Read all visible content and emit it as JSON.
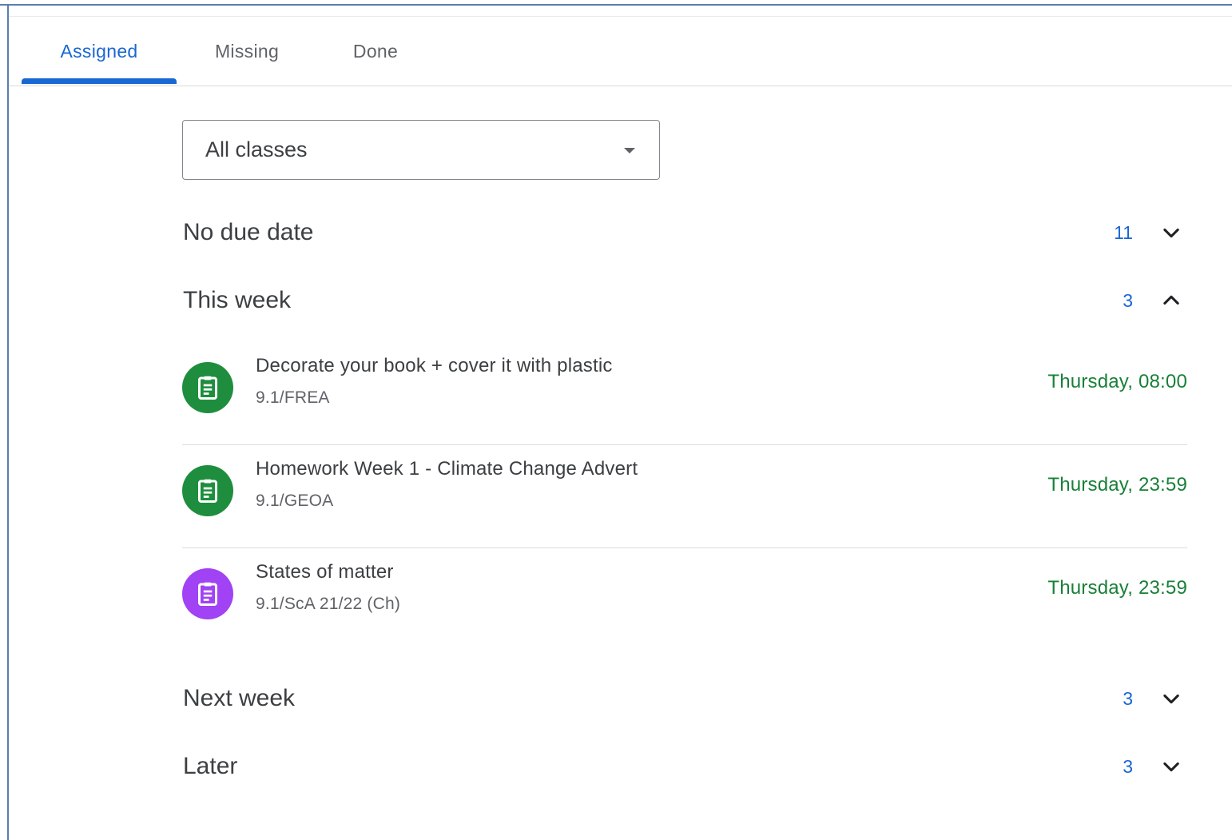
{
  "colors": {
    "accent_blue": "#1967d2",
    "due_green": "#188038",
    "icon_green": "#1e8e3e",
    "icon_purple": "#a142f4"
  },
  "tabs": [
    {
      "label": "Assigned",
      "active": true
    },
    {
      "label": "Missing",
      "active": false
    },
    {
      "label": "Done",
      "active": false
    }
  ],
  "filter": {
    "selected": "All classes",
    "icon": "caret-down-icon"
  },
  "sections": {
    "no_due_date": {
      "title": "No due date",
      "count": "11",
      "expanded": false
    },
    "this_week": {
      "title": "This week",
      "count": "3",
      "expanded": true
    },
    "next_week": {
      "title": "Next week",
      "count": "3",
      "expanded": false
    },
    "later": {
      "title": "Later",
      "count": "3",
      "expanded": false
    }
  },
  "assignments": [
    {
      "title": "Decorate your book + cover it with plastic",
      "class": "9.1/FREA",
      "due": "Thursday, 08:00",
      "icon": "assignment-icon",
      "icon_color": "#1e8e3e"
    },
    {
      "title": "Homework Week 1 - Climate Change Advert",
      "class": "9.1/GEOA",
      "due": "Thursday, 23:59",
      "icon": "assignment-icon",
      "icon_color": "#1e8e3e"
    },
    {
      "title": "States of matter",
      "class": "9.1/ScA 21/22 (Ch)",
      "due": "Thursday, 23:59",
      "icon": "assignment-icon",
      "icon_color": "#a142f4"
    }
  ]
}
